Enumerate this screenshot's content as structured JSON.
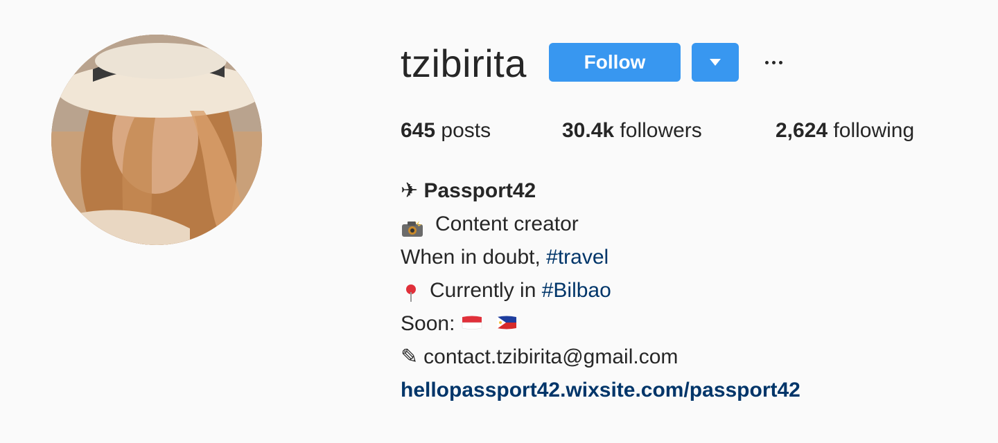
{
  "profile": {
    "username": "tzibirita",
    "follow_label": "Follow"
  },
  "stats": {
    "posts_count": "645",
    "posts_label": "posts",
    "followers_count": "30.4k",
    "followers_label": "followers",
    "following_count": "2,624",
    "following_label": "following"
  },
  "bio": {
    "name_icon": "✈",
    "name": "Passport42",
    "line1_icon": "camera-flash-icon",
    "line1": "Content creator",
    "line2_prefix": "When in doubt, ",
    "line2_hashtag": "#travel",
    "line3_icon": "pin-icon",
    "line3_prefix": "Currently in ",
    "line3_hashtag": "#Bilbao",
    "line4_prefix": "Soon:",
    "line4_flags": [
      "indonesia-flag-icon",
      "philippines-flag-icon"
    ],
    "line5_icon": "✎",
    "line5": "contact.tzibirita@gmail.com",
    "website": "hellopassport42.wixsite.com/passport42"
  },
  "colors": {
    "background": "#fafafa",
    "button": "#3897f0",
    "link": "#003569",
    "text": "#262626"
  }
}
